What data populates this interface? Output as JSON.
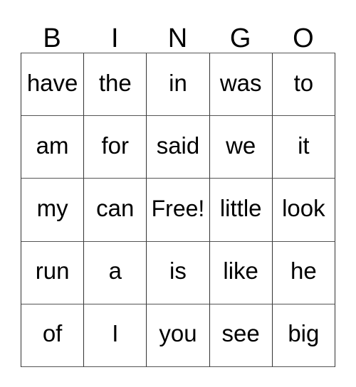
{
  "card": {
    "header_letters": [
      "B",
      "I",
      "N",
      "G",
      "O"
    ],
    "rows": [
      [
        "have",
        "the",
        "in",
        "was",
        "to"
      ],
      [
        "am",
        "for",
        "said",
        "we",
        "it"
      ],
      [
        "my",
        "can",
        "Free!",
        "little",
        "look"
      ],
      [
        "run",
        "a",
        "is",
        "like",
        "he"
      ],
      [
        "of",
        "I",
        "you",
        "see",
        "big"
      ]
    ],
    "free_space": {
      "row": 2,
      "column": 2,
      "label": "Free!"
    },
    "colors": {
      "background": "#ffffff",
      "text": "#000000",
      "grid_line": "#333333",
      "grid_line_light": "#555555"
    }
  }
}
